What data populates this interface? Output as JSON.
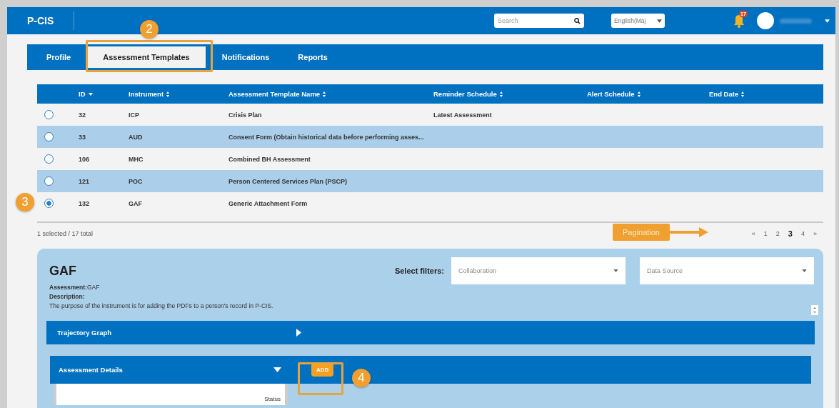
{
  "header": {
    "logo": "P-CIS",
    "search": {
      "placeholder": "Search"
    },
    "language": {
      "value": "English(Maj"
    },
    "notifications": {
      "count": "17"
    }
  },
  "tabs": [
    {
      "label": "Profile",
      "selected": false
    },
    {
      "label": "Assessment Templates",
      "selected": true
    },
    {
      "label": "Notifications",
      "selected": false
    },
    {
      "label": "Reports",
      "selected": false
    }
  ],
  "table": {
    "columns": [
      {
        "label": "ID",
        "kind": "sorted"
      },
      {
        "label": "Instrument",
        "kind": "sortable"
      },
      {
        "label": "Assessment Template Name",
        "kind": "sortable"
      },
      {
        "label": "Reminder Schedule",
        "kind": "sortable"
      },
      {
        "label": "Alert Schedule",
        "kind": "sortable"
      },
      {
        "label": "End Date",
        "kind": "sortable"
      }
    ],
    "rows": [
      {
        "selected": false,
        "cells": [
          "32",
          "ICP",
          "Crisis Plan",
          "Latest Assessment",
          "",
          ""
        ]
      },
      {
        "selected": false,
        "cells": [
          "33",
          "AUD",
          "Consent Form (Obtain historical data before performing asses...",
          "",
          "",
          ""
        ]
      },
      {
        "selected": false,
        "cells": [
          "106",
          "MHC",
          "Combined BH Assessment",
          "",
          "",
          ""
        ]
      },
      {
        "selected": false,
        "cells": [
          "121",
          "POC",
          "Person Centered Services Plan (PSCP)",
          "",
          "",
          ""
        ]
      },
      {
        "selected": true,
        "cells": [
          "132",
          "GAF",
          "Generic Attachment Form",
          "",
          "",
          ""
        ]
      }
    ],
    "summary": "1 selected / 17 total",
    "pagination": [
      {
        "label": "«",
        "selected": false
      },
      {
        "label": "1",
        "selected": false
      },
      {
        "label": "2",
        "selected": false
      },
      {
        "label": "3",
        "selected": true
      },
      {
        "label": "4",
        "selected": false
      },
      {
        "label": "»",
        "selected": false
      }
    ]
  },
  "detail": {
    "title": "GAF",
    "filters_label": "Select filters:",
    "filters": [
      {
        "placeholder": "Collaboration"
      },
      {
        "placeholder": "Data Source"
      }
    ],
    "assessment_label": "Assessment:",
    "assessment_value": "GAF",
    "description_label": "Description:",
    "description": "The purpose of the instrument is for adding the PDFs to a person's record in P-CIS.",
    "sections": [
      {
        "title": "Trajectory Graph",
        "expanded": false
      },
      {
        "title": "Assessment Details",
        "expanded": true,
        "button": "ADD",
        "columns": [
          "Status"
        ]
      }
    ]
  },
  "annotations": [
    {
      "kind": "badge",
      "label": "2"
    },
    {
      "kind": "badge",
      "label": "3"
    },
    {
      "kind": "badge",
      "label": "4"
    },
    {
      "kind": "callout",
      "label": "Pagination"
    }
  ]
}
